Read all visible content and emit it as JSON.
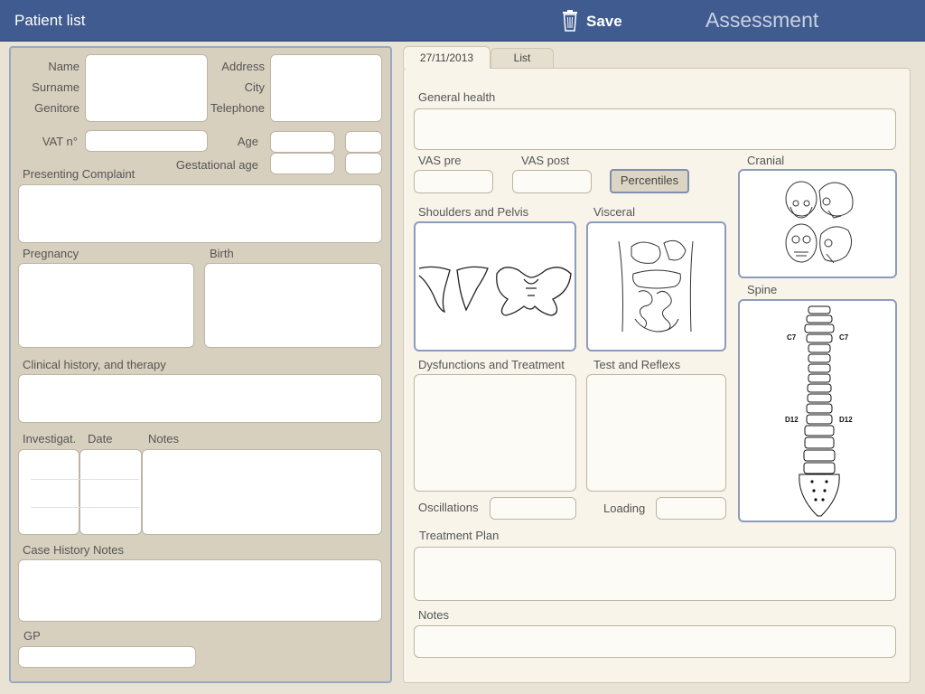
{
  "header": {
    "patient_list": "Patient list",
    "save": "Save",
    "title": "Assessment"
  },
  "tabs": {
    "date": "27/11/2013",
    "list": "List"
  },
  "left": {
    "name": "Name",
    "surname": "Surname",
    "genitore": "Genitore",
    "address": "Address",
    "city": "City",
    "telephone": "Telephone",
    "vat": "VAT n°",
    "age": "Age",
    "gestational_age": "Gestational age",
    "presenting_complaint": "Presenting Complaint",
    "pregnancy": "Pregnancy",
    "birth": "Birth",
    "clinical_history": "Clinical history, and therapy",
    "investigat": "Investigat.",
    "date": "Date",
    "notes": "Notes",
    "case_history_notes": "Case History Notes",
    "gp": "GP"
  },
  "right": {
    "general_health": "General health",
    "vas_pre": "VAS pre",
    "vas_post": "VAS post",
    "percentiles": "Percentiles",
    "cranial": "Cranial",
    "shoulders_pelvis": "Shoulders and Pelvis",
    "visceral": "Visceral",
    "spine": "Spine",
    "dysfunctions": "Dysfunctions and Treatment",
    "test_reflexes": "Test and Reflexs",
    "oscillations": "Oscillations",
    "loading": "Loading",
    "treatment_plan": "Treatment Plan",
    "notes": "Notes",
    "spine_c7": "C7",
    "spine_d12": "D12"
  },
  "icons": {
    "trash": "trash-icon"
  },
  "colors": {
    "header": "#3f5b8f",
    "left_panel": "#d8d0be",
    "right_panel": "#f8f4ea",
    "image_border": "#8d9bbc"
  }
}
